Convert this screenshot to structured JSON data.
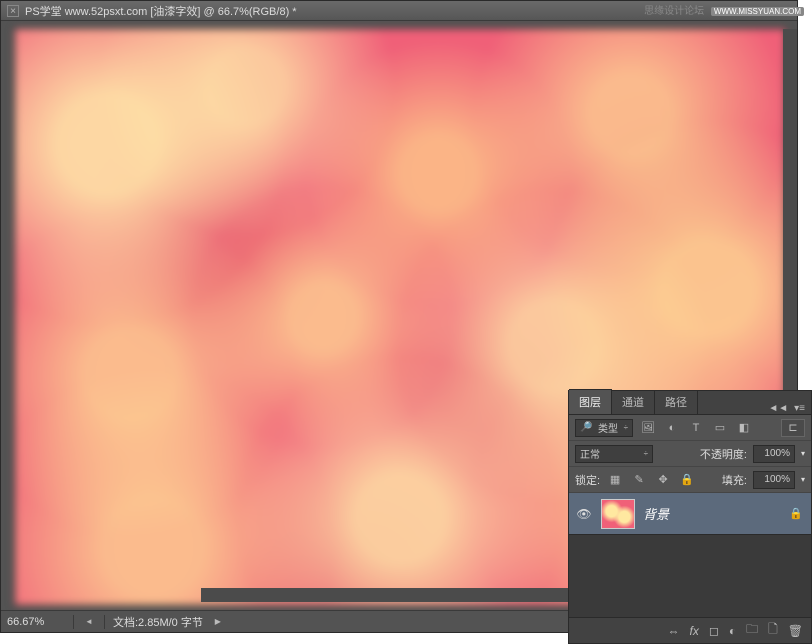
{
  "titlebar": {
    "title": "PS学堂  www.52psxt.com [油漆字效] @ 66.7%(RGB/8) *"
  },
  "statusbar": {
    "zoom": "66.67%",
    "doc_info": "文档:2.85M/0 字节"
  },
  "panel": {
    "tabs": [
      "图层",
      "通道",
      "路径"
    ],
    "filter_kind": "类型",
    "blend_mode": "正常",
    "opacity_label": "不透明度:",
    "opacity_value": "100%",
    "lock_label": "锁定:",
    "fill_label": "填充:",
    "fill_value": "100%",
    "layer_name": "背景"
  },
  "watermark": {
    "text": "思缘设计论坛",
    "site": "WWW.MISSYUAN.COM"
  }
}
